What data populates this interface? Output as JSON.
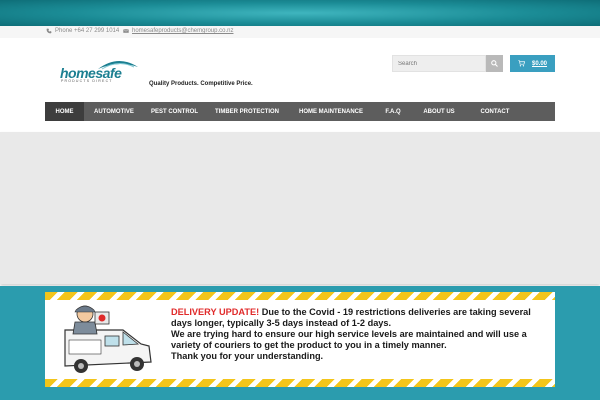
{
  "contact": {
    "phone": "Phone +64 27 299 1014",
    "email": "homesafeproducts@chemgroup.co.nz"
  },
  "logo": {
    "word": "homesafe",
    "sub": "PRODUCTS DIRECT"
  },
  "tagline": "Quality Products. Competitive Price.",
  "search": {
    "placeholder": "Search"
  },
  "cart": {
    "amount": "$0.00"
  },
  "nav": {
    "items": [
      {
        "label": "HOME",
        "active": true
      },
      {
        "label": "AUTOMOTIVE"
      },
      {
        "label": "PEST CONTROL"
      },
      {
        "label": "TIMBER PROTECTION"
      },
      {
        "label": "HOME MAINTENANCE"
      },
      {
        "label": "F.A.Q"
      },
      {
        "label": "ABOUT US"
      },
      {
        "label": "CONTACT"
      }
    ]
  },
  "banner": {
    "headline": "DELIVERY UPDATE!",
    "line1_rest": " Due to the Covid - 19 restrictions deliveries are taking several",
    "line2": "days longer, typically 3-5 days instead of 1-2 days.",
    "line3": "We are trying hard to ensure our high service levels are maintained and will use a",
    "line4": "variety of couriers to get the product to you in a timely manner.",
    "line5": "Thank you for your understanding."
  },
  "colors": {
    "brand_teal": "#1c7f91",
    "cart_blue": "#3a9fc0",
    "nav_grey": "#5d5d5d",
    "banner_red": "#e02a2a",
    "stripe_yellow": "#f3c51a",
    "footer_teal": "#2b9cae"
  },
  "icons": {
    "phone": "phone-icon",
    "email": "envelope-icon",
    "search": "search-icon",
    "cart": "cart-icon"
  }
}
